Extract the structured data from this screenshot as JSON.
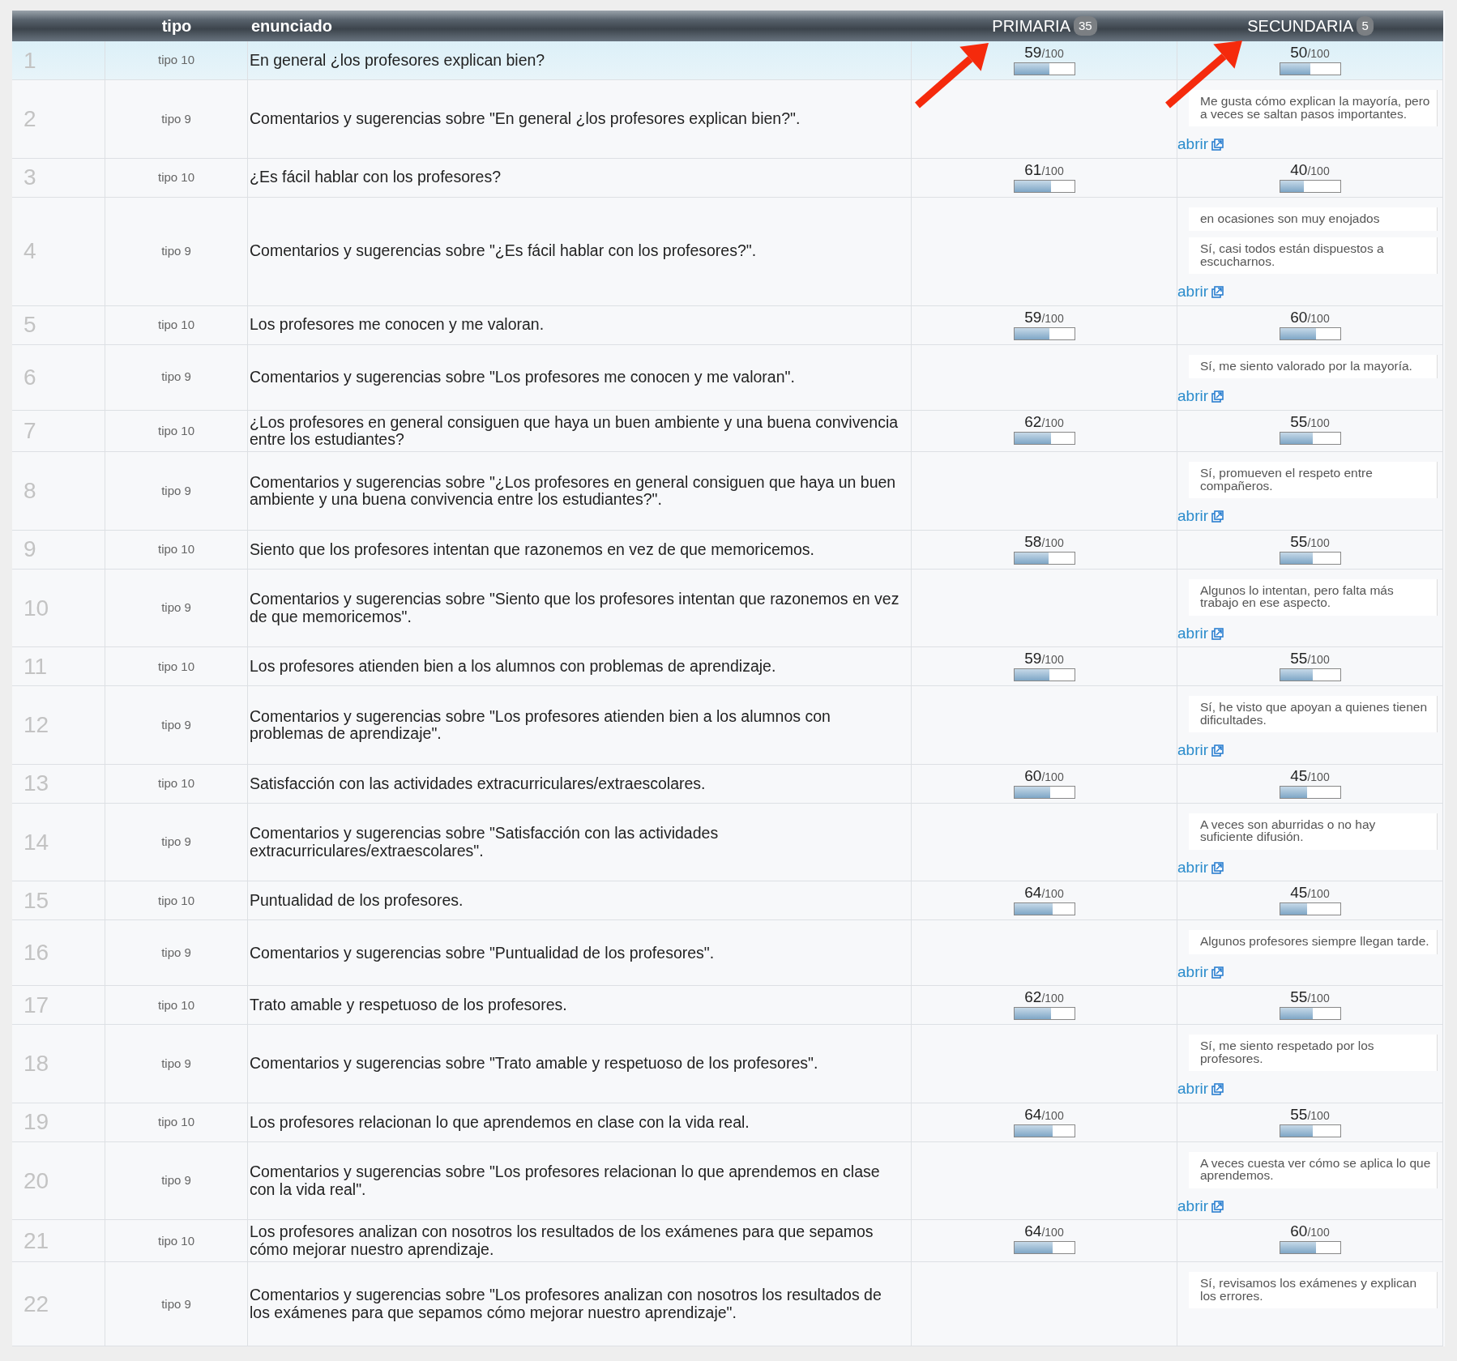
{
  "columns": [
    {
      "label": "tipo"
    },
    {
      "label": "enunciado"
    },
    {
      "label": "PRIMARIA",
      "count": "35"
    },
    {
      "label": "SECUNDARIA",
      "count": "5"
    }
  ],
  "rows": [
    {
      "number": "1",
      "tipo": "tipo 10",
      "kind": "score",
      "selected": true,
      "text": "En general ¿los profesores explican bien?",
      "primaria": {
        "score": "59",
        "max": "/100",
        "level": 0.59
      },
      "secundaria": {
        "score": "50",
        "max": "/100",
        "level": 0.5
      }
    },
    {
      "number": "2",
      "tipo": "tipo 9",
      "kind": "comments",
      "selected": false,
      "text": "Comentarios y sugerencias sobre \"En general ¿los profesores explican bien?\".",
      "secundaria": {
        "comments": [
          "Me gusta cómo explican la mayoría, pero a veces se saltan pasos importantes."
        ],
        "link": "abrir"
      }
    },
    {
      "number": "3",
      "tipo": "tipo 10",
      "kind": "score",
      "selected": false,
      "text": "¿Es fácil hablar con los profesores?",
      "primaria": {
        "score": "61",
        "max": "/100",
        "level": 0.61
      },
      "secundaria": {
        "score": "40",
        "max": "/100",
        "level": 0.4
      }
    },
    {
      "number": "4",
      "tipo": "tipo 9",
      "kind": "comments",
      "selected": false,
      "text": "Comentarios y sugerencias sobre \"¿Es fácil hablar con los profesores?\".",
      "secundaria": {
        "comments": [
          "en ocasiones son muy enojados",
          "Sí, casi todos están dispuestos a escucharnos."
        ],
        "link": "abrir"
      }
    },
    {
      "number": "5",
      "tipo": "tipo 10",
      "kind": "score",
      "selected": false,
      "text": "Los profesores me conocen y me valoran.",
      "primaria": {
        "score": "59",
        "max": "/100",
        "level": 0.59
      },
      "secundaria": {
        "score": "60",
        "max": "/100",
        "level": 0.6
      }
    },
    {
      "number": "6",
      "tipo": "tipo 9",
      "kind": "comments",
      "selected": false,
      "text": "Comentarios y sugerencias sobre \"Los profesores me conocen y me valoran\".",
      "secundaria": {
        "comments": [
          "Sí, me siento valorado por la mayoría."
        ],
        "link": "abrir"
      }
    },
    {
      "number": "7",
      "tipo": "tipo 10",
      "kind": "score",
      "selected": false,
      "text": "¿Los profesores en general consiguen que haya un buen ambiente y una buena convivencia entre los estudiantes?",
      "primaria": {
        "score": "62",
        "max": "/100",
        "level": 0.62
      },
      "secundaria": {
        "score": "55",
        "max": "/100",
        "level": 0.55
      }
    },
    {
      "number": "8",
      "tipo": "tipo 9",
      "kind": "comments",
      "selected": false,
      "text": "Comentarios y sugerencias sobre \"¿Los profesores en general consiguen que haya un buen ambiente y una buena convivencia entre los estudiantes?\".",
      "secundaria": {
        "comments": [
          "Sí, promueven el respeto entre compañeros."
        ],
        "link": "abrir"
      }
    },
    {
      "number": "9",
      "tipo": "tipo 10",
      "kind": "score",
      "selected": false,
      "text": "Siento que los profesores intentan que razonemos en vez de que memoricemos.",
      "primaria": {
        "score": "58",
        "max": "/100",
        "level": 0.58
      },
      "secundaria": {
        "score": "55",
        "max": "/100",
        "level": 0.55
      }
    },
    {
      "number": "10",
      "tipo": "tipo 9",
      "kind": "comments",
      "selected": false,
      "text": "Comentarios y sugerencias sobre \"Siento que los profesores intentan que razonemos en vez de que memoricemos\".",
      "secundaria": {
        "comments": [
          "Algunos lo intentan, pero falta más trabajo en ese aspecto."
        ],
        "link": "abrir"
      }
    },
    {
      "number": "11",
      "tipo": "tipo 10",
      "kind": "score",
      "selected": false,
      "text": "Los profesores atienden bien a los alumnos con problemas de aprendizaje.",
      "primaria": {
        "score": "59",
        "max": "/100",
        "level": 0.59
      },
      "secundaria": {
        "score": "55",
        "max": "/100",
        "level": 0.55
      }
    },
    {
      "number": "12",
      "tipo": "tipo 9",
      "kind": "comments",
      "selected": false,
      "text": "Comentarios y sugerencias sobre \"Los profesores atienden bien a los alumnos con problemas de aprendizaje\".",
      "secundaria": {
        "comments": [
          "Sí, he visto que apoyan a quienes tienen dificultades."
        ],
        "link": "abrir"
      }
    },
    {
      "number": "13",
      "tipo": "tipo 10",
      "kind": "score",
      "selected": false,
      "text": "Satisfacción con las actividades extracurriculares/extraescolares.",
      "primaria": {
        "score": "60",
        "max": "/100",
        "level": 0.6
      },
      "secundaria": {
        "score": "45",
        "max": "/100",
        "level": 0.45
      }
    },
    {
      "number": "14",
      "tipo": "tipo 9",
      "kind": "comments",
      "selected": false,
      "text": "Comentarios y sugerencias sobre \"Satisfacción con las actividades extracurriculares/extraescolares\".",
      "secundaria": {
        "comments": [
          "A veces son aburridas o no hay suficiente difusión."
        ],
        "link": "abrir"
      }
    },
    {
      "number": "15",
      "tipo": "tipo 10",
      "kind": "score",
      "selected": false,
      "text": "Puntualidad de los profesores.",
      "primaria": {
        "score": "64",
        "max": "/100",
        "level": 0.64
      },
      "secundaria": {
        "score": "45",
        "max": "/100",
        "level": 0.45
      }
    },
    {
      "number": "16",
      "tipo": "tipo 9",
      "kind": "comments",
      "selected": false,
      "text": "Comentarios y sugerencias sobre \"Puntualidad de los profesores\".",
      "secundaria": {
        "comments": [
          "Algunos profesores siempre llegan tarde."
        ],
        "link": "abrir"
      }
    },
    {
      "number": "17",
      "tipo": "tipo 10",
      "kind": "score",
      "selected": false,
      "text": "Trato amable y respetuoso de los profesores.",
      "primaria": {
        "score": "62",
        "max": "/100",
        "level": 0.62
      },
      "secundaria": {
        "score": "55",
        "max": "/100",
        "level": 0.55
      }
    },
    {
      "number": "18",
      "tipo": "tipo 9",
      "kind": "comments",
      "selected": false,
      "text": "Comentarios y sugerencias sobre \"Trato amable y respetuoso de los profesores\".",
      "secundaria": {
        "comments": [
          "Sí, me siento respetado por los profesores."
        ],
        "link": "abrir"
      }
    },
    {
      "number": "19",
      "tipo": "tipo 10",
      "kind": "score",
      "selected": false,
      "text": "Los profesores relacionan lo que aprendemos en clase con la vida real.",
      "primaria": {
        "score": "64",
        "max": "/100",
        "level": 0.64
      },
      "secundaria": {
        "score": "55",
        "max": "/100",
        "level": 0.55
      }
    },
    {
      "number": "20",
      "tipo": "tipo 9",
      "kind": "comments",
      "selected": false,
      "text": "Comentarios y sugerencias sobre \"Los profesores relacionan lo que aprendemos en clase con la vida real\".",
      "secundaria": {
        "comments": [
          "A veces cuesta ver cómo se aplica lo que aprendemos."
        ],
        "link": "abrir"
      }
    },
    {
      "number": "21",
      "tipo": "tipo 10",
      "kind": "score",
      "selected": false,
      "text": "Los profesores analizan con nosotros los resultados de los exámenes para que sepamos cómo mejorar nuestro aprendizaje.",
      "primaria": {
        "score": "64",
        "max": "/100",
        "level": 0.64
      },
      "secundaria": {
        "score": "60",
        "max": "/100",
        "level": 0.6
      }
    },
    {
      "number": "22",
      "tipo": "tipo 9",
      "kind": "comments",
      "selected": false,
      "text": "Comentarios y sugerencias sobre \"Los profesores analizan con nosotros los resultados de los exámenes para que sepamos cómo mejorar nuestro aprendizaje\".",
      "secundaria": {
        "comments": [
          "Sí, revisamos los exámenes y explican los errores."
        ]
      }
    }
  ]
}
